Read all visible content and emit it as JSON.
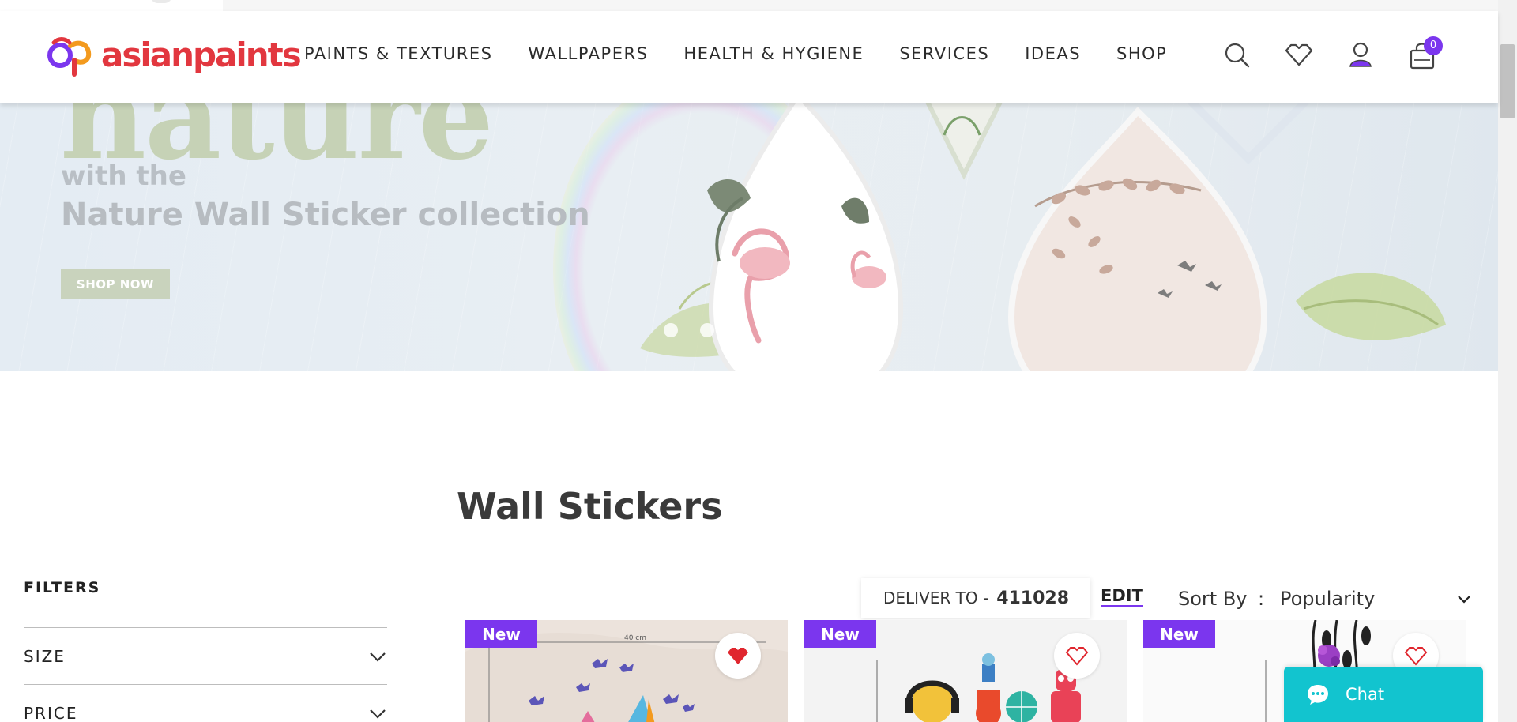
{
  "header": {
    "logo_text": "asianpaints",
    "nav": [
      {
        "label": "PAINTS & TEXTURES"
      },
      {
        "label": "WALLPAPERS"
      },
      {
        "label": "HEALTH & HYGIENE"
      },
      {
        "label": "SERVICES"
      },
      {
        "label": "IDEAS"
      },
      {
        "label": "SHOP"
      }
    ],
    "cart_count": "0",
    "icons": [
      "search-icon",
      "wishlist-icon",
      "account-icon",
      "cart-icon"
    ]
  },
  "banner": {
    "big_word": "nature",
    "line1": "with the",
    "line2": "Nature Wall Sticker collection",
    "button_label": "SHOP NOW"
  },
  "main": {
    "title": "Wall Stickers",
    "filters_title": "FILTERS",
    "filters": [
      {
        "label": "SIZE"
      },
      {
        "label": "PRICE"
      }
    ],
    "deliver_label": "DELIVER TO -",
    "pincode": "411028",
    "edit_label": "EDIT",
    "sort_label": "Sort By",
    "sort_colon": ":",
    "sort_value": "Popularity",
    "products": [
      {
        "badge": "New",
        "wishlisted": true,
        "dim": "40 cm"
      },
      {
        "badge": "New",
        "wishlisted": false,
        "dim": ""
      },
      {
        "badge": "New",
        "wishlisted": false,
        "dim": ""
      }
    ]
  },
  "chat": {
    "label": "Chat"
  },
  "colors": {
    "brand_red": "#e2373f",
    "accent_purple": "#7b36ee",
    "chat_teal": "#12c4cf"
  }
}
